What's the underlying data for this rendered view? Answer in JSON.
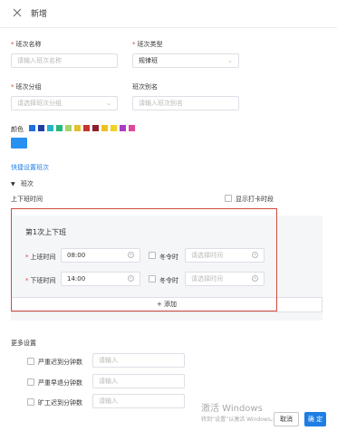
{
  "header": {
    "title": "新增"
  },
  "form": {
    "shift_name": {
      "label": "班次名称",
      "placeholder": "请输入班次名称"
    },
    "shift_type": {
      "label": "班次类型",
      "value": "规律班"
    },
    "shift_group": {
      "label": "班次分组",
      "placeholder": "请选择班次分组"
    },
    "shift_alias": {
      "label": "班次别名",
      "placeholder": "请输入班次别名"
    },
    "color": {
      "label": "颜色",
      "swatches": [
        "#1e6fe0",
        "#1a3fa8",
        "#26b3c9",
        "#25b87a",
        "#a6d46a",
        "#e2c12b",
        "#c5352d",
        "#8c2030",
        "#f0c11d",
        "#f0d422",
        "#a83ec4",
        "#e0479a"
      ],
      "selected_color": "#2891f0"
    },
    "quick_setup_link": "快捷设置班次",
    "section_toggle": "班次",
    "work_time_label": "上下班时间",
    "show_punch_label": "显示打卡时段",
    "shift_block": {
      "title": "第1次上下班",
      "start_label": "上班时间",
      "start_value": "08:00",
      "end_label": "下班时间",
      "end_value": "14:00",
      "winter_label": "冬令时",
      "winter_placeholder": "请选择时间",
      "winter_placeholder_2": "请选择时间"
    },
    "add_button": "+ 添加",
    "more_settings": {
      "title": "更多设置",
      "items": [
        {
          "label": "严重迟到分钟数",
          "placeholder": "请输入"
        },
        {
          "label": "严重早退分钟数",
          "placeholder": "请输入"
        },
        {
          "label": "旷工迟到分钟数",
          "placeholder": "请输入"
        }
      ]
    }
  },
  "footer": {
    "cancel": "取消",
    "ok": "确 定"
  },
  "watermark": {
    "line1": "激活 Windows",
    "line2": "转到“设置”以激活 Windows。"
  }
}
